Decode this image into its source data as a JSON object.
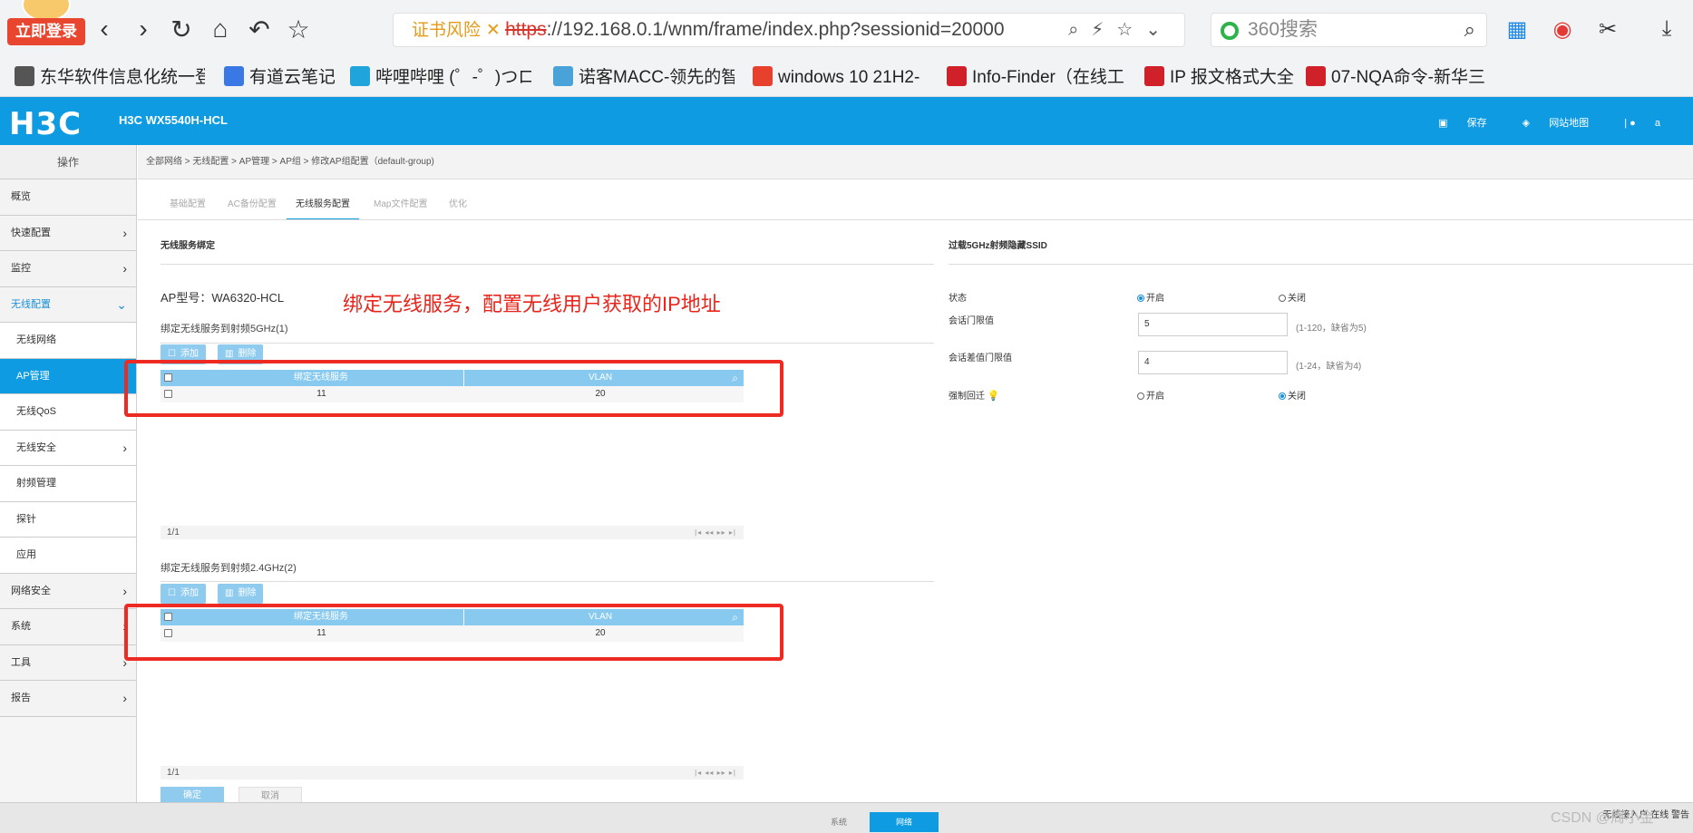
{
  "browser": {
    "login_badge": "立即登录",
    "url_warning": "证书风险",
    "url_scheme": "https",
    "url_rest": "://192.168.0.1/wnm/frame/index.php?sessionid=20000",
    "search_placeholder": "360搜索",
    "bookmarks": [
      "东华软件信息化统一登",
      "有道云笔记",
      "哔哩哔哩 (゜-゜)つロ",
      "诺客MACC-领先的智",
      "windows 10 21H2-",
      "Info-Finder（在线工",
      "IP 报文格式大全",
      "07-NQA命令-新华三"
    ]
  },
  "header": {
    "logo": "H3C",
    "model": "H3C WX5540H-HCL",
    "save": "保存",
    "sitemap": "网站地图",
    "user": "a"
  },
  "sidebar": {
    "title": "操作",
    "items": [
      {
        "label": "概览"
      },
      {
        "label": "快速配置"
      },
      {
        "label": "监控"
      },
      {
        "label": "无线配置"
      },
      {
        "label": "无线网络"
      },
      {
        "label": "AP管理"
      },
      {
        "label": "无线QoS"
      },
      {
        "label": "无线安全"
      },
      {
        "label": "射频管理"
      },
      {
        "label": "探针"
      },
      {
        "label": "应用"
      },
      {
        "label": "网络安全"
      },
      {
        "label": "系统"
      },
      {
        "label": "工具"
      },
      {
        "label": "报告"
      }
    ]
  },
  "breadcrumb": "全部网络 > 无线配置 > AP管理 > AP组 > 修改AP组配置（default-group)",
  "tabs": [
    "基础配置",
    "AC备份配置",
    "无线服务配置",
    "Map文件配置",
    "优化"
  ],
  "left": {
    "section_title": "无线服务绑定",
    "ap_model": "AP型号：WA6320-HCL",
    "annotation": "绑定无线服务，配置无线用户获取的IP地址",
    "group5": {
      "label": "绑定无线服务到射频5GHz(1)",
      "add": "添加",
      "delete": "删除",
      "col1": "绑定无线服务",
      "col2": "VLAN",
      "rows": [
        {
          "service": "11",
          "vlan": "20"
        }
      ],
      "pager": "1/1"
    },
    "group24": {
      "label": "绑定无线服务到射频2.4GHz(2)",
      "add": "添加",
      "delete": "删除",
      "col1": "绑定无线服务",
      "col2": "VLAN",
      "rows": [
        {
          "service": "11",
          "vlan": "20"
        }
      ],
      "pager": "1/1"
    },
    "confirm": "确定",
    "cancel": "取消"
  },
  "right": {
    "section_title": "过载5GHz射频隐藏SSID",
    "status_label": "状态",
    "on": "开启",
    "off": "关闭",
    "session_label": "会话门限值",
    "session_value": "5",
    "session_hint": "(1-120，缺省为5)",
    "diff_label": "会话差值门限值",
    "diff_value": "4",
    "diff_hint": "(1-24，缺省为4)",
    "force_label": "强制回迁"
  },
  "footer": {
    "sys_tab": "系统",
    "net_tab": "网络",
    "right": "无线接入户  在线  警告",
    "watermark": "CSDN @周小金"
  }
}
